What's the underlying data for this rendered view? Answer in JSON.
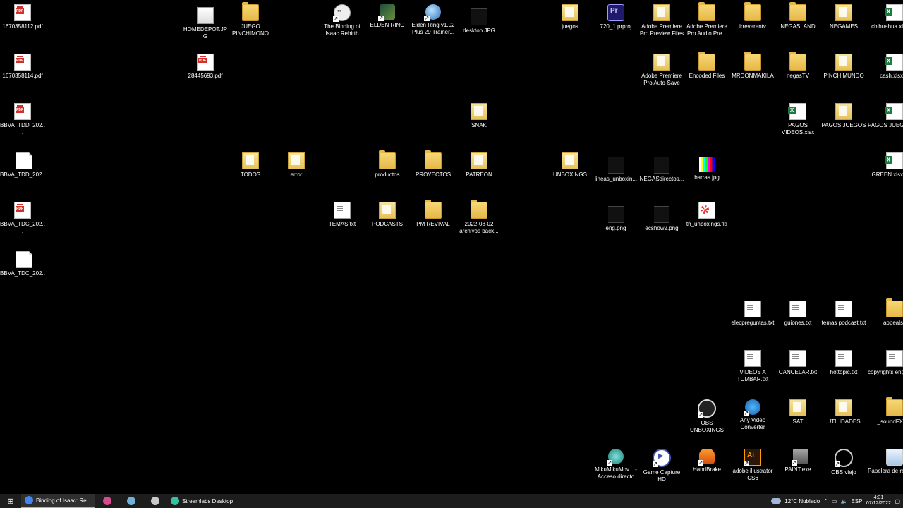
{
  "desktop_icons": [
    {
      "id": "pdf1",
      "label": "1670358112.pdf",
      "type": "pdf"
    },
    {
      "id": "pdf2",
      "label": "1670358114.pdf",
      "type": "pdf"
    },
    {
      "id": "bbva1",
      "label": "BBVA_TDD_202...",
      "type": "pdf"
    },
    {
      "id": "bbva2",
      "label": "BBVA_TDD_202...",
      "type": "doc"
    },
    {
      "id": "bbva3",
      "label": "BBVA_TDC_202...",
      "type": "pdf"
    },
    {
      "id": "bbva4",
      "label": "BBVA_TDC_202...",
      "type": "doc"
    },
    {
      "id": "homedepot",
      "label": "HOMEDEPOT.JPG",
      "type": "img"
    },
    {
      "id": "pdf3",
      "label": "28445693.pdf",
      "type": "pdf"
    },
    {
      "id": "juego",
      "label": "JUEGO PINCHIMONO",
      "type": "folder"
    },
    {
      "id": "isaac",
      "label": "The Binding of Isaac Rebirth",
      "type": "isaac"
    },
    {
      "id": "elden",
      "label": "ELDEN RING",
      "type": "game"
    },
    {
      "id": "trainer",
      "label": "Elden Ring v1.02 Plus 29 Trainer...",
      "type": "globe"
    },
    {
      "id": "desktopjpg",
      "label": "desktop.JPG",
      "type": "img-dark"
    },
    {
      "id": "snak",
      "label": "SNAK",
      "type": "folder-doc"
    },
    {
      "id": "todos",
      "label": "TODOS",
      "type": "folder-doc"
    },
    {
      "id": "error",
      "label": "error",
      "type": "folder-doc"
    },
    {
      "id": "productos",
      "label": "productos",
      "type": "folder"
    },
    {
      "id": "proyectos",
      "label": "PROYECTOS",
      "type": "folder"
    },
    {
      "id": "patreon",
      "label": "PATREON",
      "type": "folder-doc"
    },
    {
      "id": "temas",
      "label": "TEMAS.txt",
      "type": "txt"
    },
    {
      "id": "podcasts",
      "label": "PODCASTS",
      "type": "folder-doc"
    },
    {
      "id": "pmrevival",
      "label": "PM REVIVAL",
      "type": "folder"
    },
    {
      "id": "archivos",
      "label": "2022-08-02 archivos back...",
      "type": "folder"
    },
    {
      "id": "juegos",
      "label": "juegos",
      "type": "folder-doc"
    },
    {
      "id": "prproj",
      "label": "720_1.prproj",
      "type": "pr"
    },
    {
      "id": "prpreview",
      "label": "Adobe Premiere Pro Preview Files",
      "type": "folder-doc"
    },
    {
      "id": "praudio",
      "label": "Adobe Premiere Pro Audio Pre...",
      "type": "folder"
    },
    {
      "id": "irreverent",
      "label": "irreverentv",
      "type": "folder"
    },
    {
      "id": "negasland",
      "label": "NEGASLAND",
      "type": "folder"
    },
    {
      "id": "negames",
      "label": "NEGAMES",
      "type": "folder-doc"
    },
    {
      "id": "chihuahua",
      "label": "chihuahua.xl",
      "type": "xlsx"
    },
    {
      "id": "prauto",
      "label": "Adobe Premiere Pro Auto-Save",
      "type": "folder-doc"
    },
    {
      "id": "encoded",
      "label": "Encoded Files",
      "type": "folder"
    },
    {
      "id": "mrdon",
      "label": "MRDONMAKILA",
      "type": "folder"
    },
    {
      "id": "negastv",
      "label": "negasTV",
      "type": "folder"
    },
    {
      "id": "pinchimundo",
      "label": "PINCHIMUNDO",
      "type": "folder-doc"
    },
    {
      "id": "cash",
      "label": "cash.xlsx",
      "type": "xlsx"
    },
    {
      "id": "pagosvid",
      "label": "PAGOS VIDEOS.xlsx",
      "type": "xlsx"
    },
    {
      "id": "pagosjuegosf",
      "label": "PAGOS JUEGOS",
      "type": "folder-doc"
    },
    {
      "id": "pagosjuegosx",
      "label": "PAGOS JUEGOS.xls",
      "type": "xlsx"
    },
    {
      "id": "unboxings",
      "label": "UNBOXINGS",
      "type": "folder-doc"
    },
    {
      "id": "lineas",
      "label": "lineas_unboxin...",
      "type": "img-dark"
    },
    {
      "id": "negasdir",
      "label": "NEGASdirectos...",
      "type": "img-dark"
    },
    {
      "id": "barras",
      "label": "barras.jpg",
      "type": "bars"
    },
    {
      "id": "green",
      "label": "GREEN.xlsx",
      "type": "xlsx"
    },
    {
      "id": "eng",
      "label": "eng.png",
      "type": "img-dark"
    },
    {
      "id": "ecshow",
      "label": "ecshow2.png",
      "type": "img-dark"
    },
    {
      "id": "thunbox",
      "label": "th_unboxings.fla",
      "type": "fla"
    },
    {
      "id": "elecpreg",
      "label": "elecpreguntas.txt",
      "type": "txt"
    },
    {
      "id": "guiones",
      "label": "guiones.txt",
      "type": "txt"
    },
    {
      "id": "temaspod",
      "label": "temas podcast.txt",
      "type": "txt"
    },
    {
      "id": "appeals",
      "label": "appeals",
      "type": "folder"
    },
    {
      "id": "videostumbar",
      "label": "VIDEOS A TUMBAR.txt",
      "type": "txt"
    },
    {
      "id": "cancelar",
      "label": "CANCELAR.txt",
      "type": "txt"
    },
    {
      "id": "hottopic",
      "label": "hottopic.txt",
      "type": "txt"
    },
    {
      "id": "copyrights",
      "label": "copyrights english desc",
      "type": "txt"
    },
    {
      "id": "obsunbox",
      "label": "OBS UNBOXINGS",
      "type": "obs"
    },
    {
      "id": "anyvideo",
      "label": "Any Video Converter",
      "type": "anyvid"
    },
    {
      "id": "sat",
      "label": "SAT",
      "type": "folder-doc"
    },
    {
      "id": "utilidades",
      "label": "UTILIDADES",
      "type": "folder-doc"
    },
    {
      "id": "soundfx",
      "label": "_soundFX",
      "type": "folder"
    },
    {
      "id": "miku",
      "label": "MikuMikuMov... - Acceso directo",
      "type": "miku"
    },
    {
      "id": "gamecapture",
      "label": "Game Capture HD",
      "type": "gc"
    },
    {
      "id": "handbrake",
      "label": "HandBrake",
      "type": "hb"
    },
    {
      "id": "illustrator",
      "label": "adobe illustrator CS6",
      "type": "ai"
    },
    {
      "id": "paint",
      "label": "PAINT.exe",
      "type": "paint"
    },
    {
      "id": "obsviejo",
      "label": "OBS viejo",
      "type": "obsv"
    },
    {
      "id": "papelera",
      "label": "Papelera de reciclaje",
      "type": "bin"
    }
  ],
  "taskbar": {
    "start_icon": "windows-start-icon",
    "items": [
      {
        "label": "Binding of Isaac: Re...",
        "icon": "chrome-icon",
        "active": true,
        "color": "#4285f4"
      },
      {
        "label": "",
        "icon": "pinwheel-icon",
        "active": false,
        "color": "#d64a8f"
      },
      {
        "label": "",
        "icon": "tools-icon",
        "active": false,
        "color": "#6fb3d9"
      },
      {
        "label": "",
        "icon": "gamepad-icon",
        "active": false,
        "color": "#c9c9c9"
      },
      {
        "label": "Streamlabs Desktop",
        "icon": "streamlabs-icon",
        "active": false,
        "color": "#31c3a2"
      }
    ],
    "weather": "12°C Nublado",
    "language": "ESP",
    "time": "4:31",
    "date": "07/12/2022"
  }
}
